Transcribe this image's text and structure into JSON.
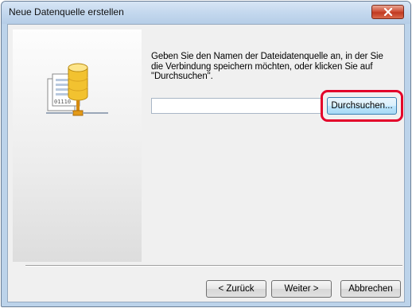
{
  "window": {
    "title": "Neue Datenquelle erstellen",
    "close_icon": "close-x-icon"
  },
  "side_panel": {
    "icon": "data-source-database-icon",
    "icon_caption": "01110"
  },
  "main": {
    "instructions": "Geben Sie den Namen der Dateidatenquelle an, in der Sie\ndie Verbindung speichern möchten, oder klicken Sie auf\n\"Durchsuchen\".",
    "name_input": {
      "value": "",
      "placeholder": ""
    },
    "browse_label": "Durchsuchen..."
  },
  "footer": {
    "back_label": "< Zurück",
    "next_label": "Weiter >",
    "cancel_label": "Abbrechen"
  },
  "colors": {
    "highlight": "#e3002a",
    "close_button": "#c13a22",
    "frame": "#bcd3ea"
  }
}
